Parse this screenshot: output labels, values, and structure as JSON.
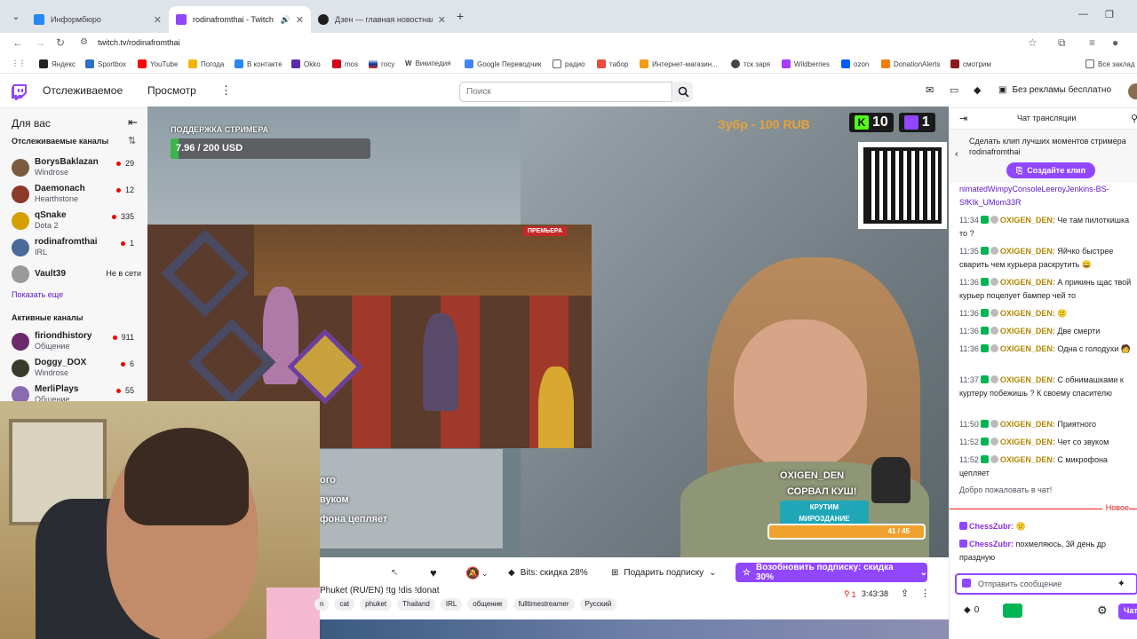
{
  "browser": {
    "tabs": [
      {
        "title": "Информбюро",
        "active": false
      },
      {
        "title": "rodinafromthai - Twitch",
        "active": true
      },
      {
        "title": "Дзен — главная новостная ин",
        "active": false
      }
    ],
    "url": "twitch.tv/rodinafromthai",
    "bookmarks": [
      "Яндекс",
      "Sportbox",
      "YouTube",
      "Погода",
      "В контакте",
      "Okko",
      "mos",
      "госу",
      "Википедия",
      "Google Переводчик",
      "радио",
      "табор",
      "Интернет-магазин...",
      "тск заря",
      "Wildberries",
      "ozon",
      "DonationAlerts",
      "смотрим",
      "Все заклад"
    ]
  },
  "header": {
    "nav_following": "Отслеживаемое",
    "nav_browse": "Просмотр",
    "search_placeholder": "Поиск",
    "no_ads": "Без рекламы бесплатно"
  },
  "sidebar": {
    "title": "Для вас",
    "followed_title": "Отслеживаемые каналы",
    "followed": [
      {
        "name": "BorysBaklazan",
        "game": "Windrose",
        "viewers": "29",
        "color": "#7a5c3e"
      },
      {
        "name": "Daemonach",
        "game": "Hearthstone",
        "viewers": "12",
        "color": "#8a3a2a"
      },
      {
        "name": "qSnake",
        "game": "Dota 2",
        "viewers": "335",
        "color": "#d3a000"
      },
      {
        "name": "rodinafromthai",
        "game": "IRL",
        "viewers": "1",
        "color": "#4a6a9a"
      },
      {
        "name": "Vault39",
        "game": "",
        "viewers": "Не в сети",
        "color": "#9a9a9a"
      }
    ],
    "show_more": "Показать еще",
    "active_title": "Активные каналы",
    "active": [
      {
        "name": "firiondhistory",
        "game": "Общение",
        "viewers": "911",
        "color": "#6a2a6a"
      },
      {
        "name": "Doggy_DOX",
        "game": "Windrose",
        "viewers": "6",
        "color": "#3a3a2a"
      },
      {
        "name": "MerliPlays",
        "game": "Общение",
        "viewers": "55",
        "color": "#8a6ab0"
      }
    ]
  },
  "overlay": {
    "support_label": "ПОДДЕРЖКА СТРИМЕРА",
    "support_amount": "7.96 / 200 USD",
    "support_progress": 0.04,
    "zubr": "Зубр - 100 RUB",
    "kick_count": "10",
    "twitch_count": "1",
    "premiere": "ПРЕМЬЕРА",
    "chat_lines": [
      "ого",
      "вуком",
      "фона цепляет"
    ],
    "alert_name": "OXIGEN_DEN",
    "alert_msg": "СОРВАЛ КУШ!",
    "alert_badge_1": "КРУТИМ",
    "alert_badge_2": "МИРОЗДАНИЕ",
    "alert_count": "41 / 45"
  },
  "player": {
    "bits": "Bits: скидка 28%",
    "gift_sub": "Подарить подписку",
    "resub": "Возобновить подписку: скидка 30%",
    "stream_title": "Phuket (RU/EN) !tg !dis !donat",
    "tags": [
      "n",
      "cat",
      "phuket",
      "Thailand",
      "IRL",
      "общение",
      "fulltimestreamer",
      "Русский"
    ],
    "viewers": "1",
    "uptime": "3:43:38"
  },
  "chat": {
    "title": "Чат трансляции",
    "clip_text": "Сделать клип лучших моментов стримера rodinafromthai",
    "clip_button": "Создайте клип",
    "link_text": "nimatedWimpyConsoleLeeroyJenkins-BS-SfKIk_UMom33R",
    "messages": [
      {
        "time": "11:34",
        "user": "OXIGEN_DEN:",
        "text": "Че там пилоткишка то ?"
      },
      {
        "time": "11:35",
        "user": "OXIGEN_DEN:",
        "text": "Яйчко быстрее сварить чем курьера раскрутить 😄"
      },
      {
        "time": "11:36",
        "user": "OXIGEN_DEN:",
        "text": "А прикинь щас твой курьер поцелует бампер чей то"
      },
      {
        "time": "11:36",
        "user": "OXIGEN_DEN:",
        "text": "🙂"
      },
      {
        "time": "11:36",
        "user": "OXIGEN_DEN:",
        "text": "Две смерти"
      },
      {
        "time": "11:36",
        "user": "OXIGEN_DEN:",
        "text": "Одна с голодухи 🧑"
      },
      {
        "time": "11:37",
        "user": "OXIGEN_DEN:",
        "text": "С обнимашками к куртеру побежишь ? К своему спасителю"
      },
      {
        "time": "11:50",
        "user": "OXIGEN_DEN:",
        "text": "Приятного"
      },
      {
        "time": "11:52",
        "user": "OXIGEN_DEN:",
        "text": "Чет со звуком"
      },
      {
        "time": "11:52",
        "user": "OXIGEN_DEN:",
        "text": "С микрофона цепляет"
      }
    ],
    "welcome": "Добро пожаловать в чат!",
    "new_label": "Новое",
    "new_messages": [
      {
        "user": "ChessZubr:",
        "text": "🙂"
      },
      {
        "user": "ChessZubr:",
        "text": "похмеляюсь, 3й день др праздную"
      }
    ],
    "input_placeholder": "Отправить сообщение",
    "points": "0",
    "send": "Чат"
  },
  "colors": {
    "twitch_purple": "#9146ff",
    "live_red": "#eb0400",
    "user_gold": "#b38600",
    "user_purple": "#8a2be2"
  }
}
